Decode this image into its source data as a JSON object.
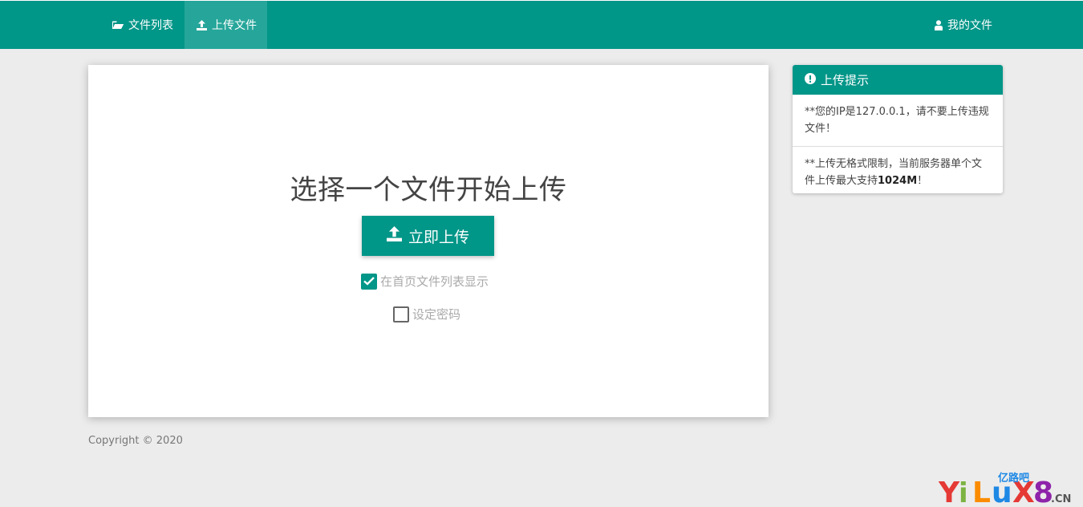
{
  "nav": {
    "file_list": "文件列表",
    "upload_file": "上传文件",
    "my_files": "我的文件"
  },
  "main": {
    "title": "选择一个文件开始上传",
    "upload_button": "立即上传",
    "show_on_home_label": "在首页文件列表显示",
    "show_on_home_checked": true,
    "set_password_label": "设定密码",
    "set_password_checked": false
  },
  "footer": {
    "copyright": "Copyright © 2020"
  },
  "tips": {
    "title": "上传提示",
    "items": [
      {
        "prefix": "**您的IP是127.0.0.1，请不要上传违规文件！"
      },
      {
        "prefix": "**上传无格式限制，当前服务器单个文件上传最大支持",
        "strong": "1024M",
        "suffix": "！"
      }
    ]
  },
  "watermark": {
    "text": "YiLuX8",
    "cn_text": "亿路吧",
    "domain": ".CN"
  },
  "colors": {
    "accent": "#009688",
    "accent_active": "#26a69a",
    "background": "#ececec"
  }
}
